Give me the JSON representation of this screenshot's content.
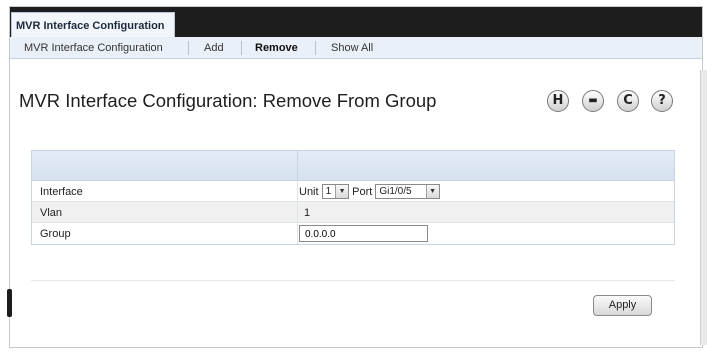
{
  "app_tab": {
    "label": "MVR Interface Configuration"
  },
  "subnav": {
    "items": [
      {
        "label": "MVR Interface Configuration"
      },
      {
        "label": "Add"
      },
      {
        "label": "Remove"
      },
      {
        "label": "Show All"
      }
    ],
    "active": "Remove"
  },
  "page": {
    "title": "MVR Interface Configuration: Remove From Group"
  },
  "toolbar": {
    "save_glyph": "H",
    "print_glyph": "▬",
    "refresh_glyph": "C",
    "help_glyph": "?",
    "icons": [
      "save-icon",
      "print-icon",
      "refresh-icon",
      "help-icon"
    ]
  },
  "form": {
    "interface": {
      "label": "Interface",
      "unit_label": "Unit",
      "unit_value": "1",
      "port_label": "Port",
      "port_value": "Gi1/0/5"
    },
    "vlan": {
      "label": "Vlan",
      "value": "1"
    },
    "group": {
      "label": "Group",
      "value": "0.0.0.0"
    }
  },
  "actions": {
    "apply_label": "Apply"
  },
  "colors": {
    "tabbar_bg": "#1d1d1d",
    "subnav_bg": "#eaf0f8",
    "table_header": "#d6e2f1"
  }
}
